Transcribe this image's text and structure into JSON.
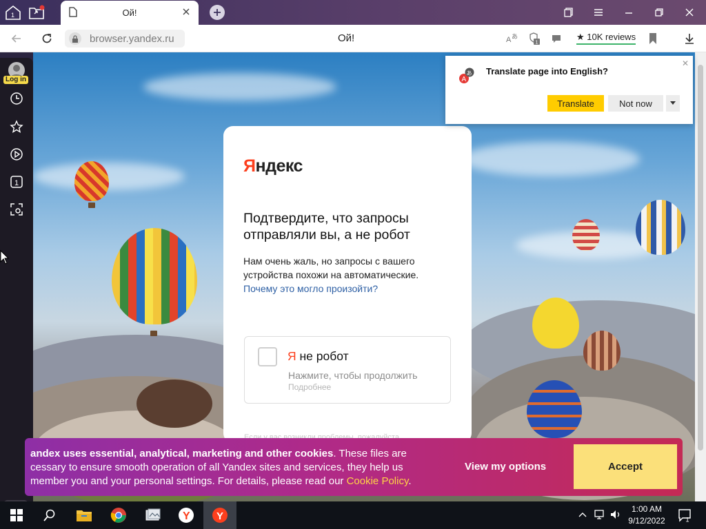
{
  "tab": {
    "title": "Ой!"
  },
  "address": {
    "url": "browser.yandex.ru",
    "page_title": "Ой!",
    "reviews": "★ 10K reviews"
  },
  "sidebar": {
    "login_label": "Log in",
    "tab_count": "1"
  },
  "captcha": {
    "logo_first": "Я",
    "logo_rest": "ндекс",
    "heading": "Подтвердите, что запросы отправляли вы, а не робот",
    "description": "Нам очень жаль, но запросы с вашего устройства похожи на автоматические.",
    "why_link": "Почему это могло произойти?",
    "robot_first": "Я",
    "robot_rest": " не робот",
    "robot_hint": "Нажмите, чтобы продолжить",
    "robot_more": "Подробнее",
    "footer_faded": "Если у вас возникли проблемы, пожалуйста"
  },
  "translate": {
    "title": "Translate page into English?",
    "translate_button": "Translate",
    "not_now_button": "Not now"
  },
  "cookie": {
    "bold_text": "andex uses essential, analytical, marketing and other cookies",
    "body_text": ". These files are\ncessary to ensure smooth operation of all Yandex sites and services, they help us\nmember you and your personal settings. For details, please read our ",
    "policy_link": "Cookie Policy",
    "end": ".",
    "view_options": "View my options",
    "accept": "Accept"
  },
  "taskbar": {
    "time": "1:00 AM",
    "date": "9/12/2022",
    "notifications": "1"
  },
  "colors": {
    "yandex_red": "#fc3f1d",
    "yandex_yellow": "#ffcc00",
    "link_blue": "#2d5fa4"
  }
}
